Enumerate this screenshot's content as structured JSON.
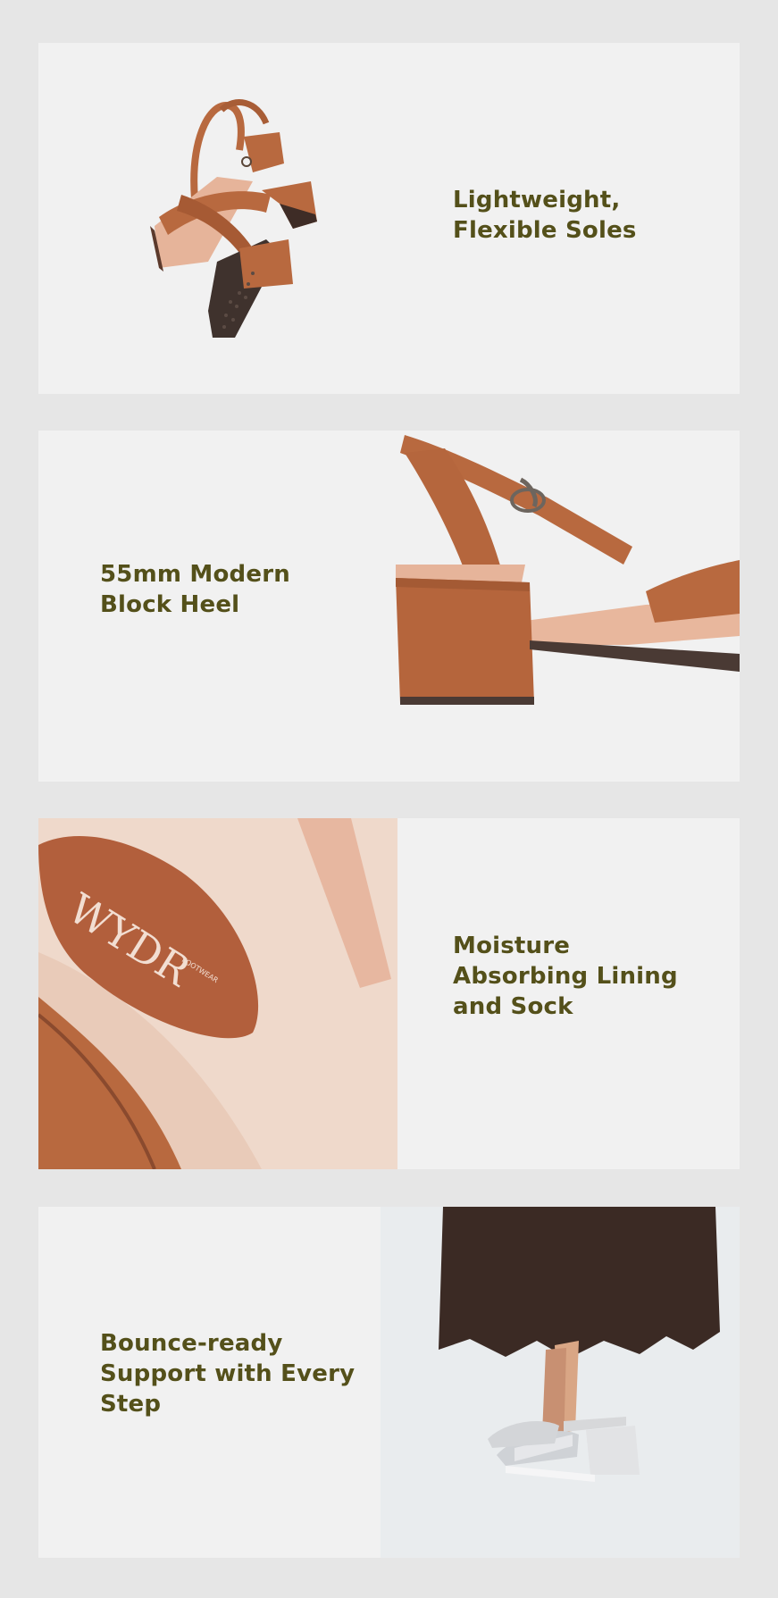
{
  "features": [
    {
      "caption_lines": [
        "Lightweight,",
        "Flexible Soles"
      ],
      "image": "floating-sandal-pair-photo"
    },
    {
      "caption_lines": [
        "55mm Modern",
        "Block Heel"
      ],
      "image": "block-heel-closeup-photo"
    },
    {
      "caption_lines": [
        "Moisture",
        "Absorbing Lining",
        "and Sock"
      ],
      "image": "insole-lining-closeup-photo",
      "logo_text": "WYDR",
      "logo_subtext": "FOOTWEAR"
    },
    {
      "caption_lines": [
        "Bounce-ready",
        "Support with Every",
        "Step"
      ],
      "image": "model-wearing-silver-sandals-photo"
    }
  ],
  "colors": {
    "page_bg": "#e6e6e6",
    "panel_bg": "#f1f1f1",
    "caption_text": "#54501a",
    "leather_tan": "#b8693f",
    "lining_pink": "#e6b49a",
    "sole_dark": "#4a3a34",
    "skirt_brown": "#3b2a24",
    "silver": "#d7d8da"
  }
}
